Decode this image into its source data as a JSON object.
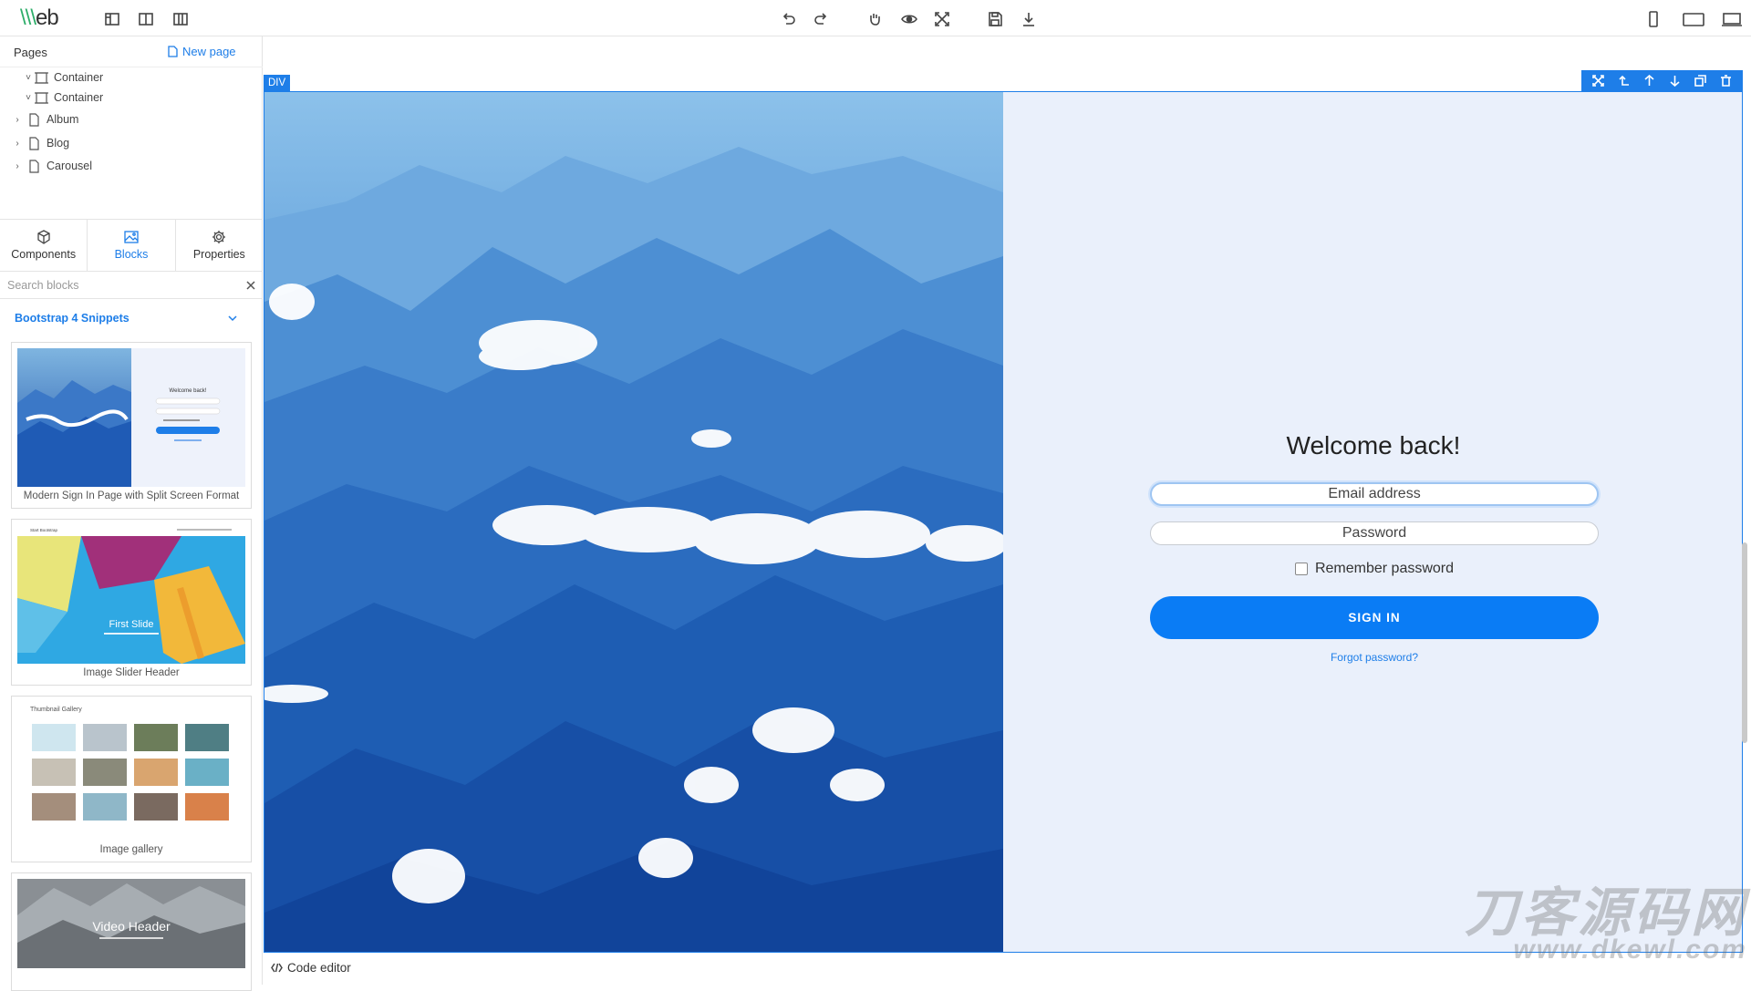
{
  "app": {
    "logo_a": "\\\\\\",
    "logo_b": "eb"
  },
  "toolbar": {
    "left_icons": [
      "layout-sidebar-left-icon",
      "layout-columns-icon",
      "layout-sidebar-right-icon"
    ],
    "center_icons": [
      "undo-icon",
      "redo-icon",
      "drag-hand-icon",
      "preview-eye-icon",
      "fullscreen-icon",
      "save-icon",
      "download-icon"
    ],
    "right_icons": [
      "mobile-view-icon",
      "tablet-view-icon",
      "desktop-view-icon"
    ]
  },
  "pages_panel": {
    "title": "Pages",
    "new_page_label": "New page",
    "tree": [
      {
        "label": "Container",
        "type": "container",
        "expanded": true
      },
      {
        "label": "Container",
        "type": "container",
        "expanded": true
      },
      {
        "label": "Album",
        "type": "page",
        "expanded": false
      },
      {
        "label": "Blog",
        "type": "page",
        "expanded": false
      },
      {
        "label": "Carousel",
        "type": "page",
        "expanded": false
      }
    ]
  },
  "tabs": [
    {
      "label": "Components",
      "icon": "cube-icon",
      "active": false
    },
    {
      "label": "Blocks",
      "icon": "image-icon",
      "active": true
    },
    {
      "label": "Properties",
      "icon": "gear-icon",
      "active": false
    }
  ],
  "blocks": {
    "search_placeholder": "Search blocks",
    "group_title": "Bootstrap 4 Snippets",
    "cards": [
      {
        "caption": "Modern Sign In Page with Split Screen Format",
        "mini_welcome": "Welcome back!"
      },
      {
        "caption": "Image Slider Header",
        "mini_brand": "Start Bootstrap",
        "mini_slide": "First Slide"
      },
      {
        "caption": "Image gallery",
        "mini_title": "Thumbnail Gallery"
      },
      {
        "caption": "",
        "mini_title": "Video Header"
      }
    ]
  },
  "canvas": {
    "selected_tag": "DIV",
    "selection_actions": [
      "select-parent-icon",
      "move-up-parent-icon",
      "arrow-up-icon",
      "arrow-down-icon",
      "clone-icon",
      "trash-icon"
    ],
    "signin": {
      "heading": "Welcome back!",
      "email_placeholder": "Email address",
      "password_placeholder": "Password",
      "remember_label": "Remember password",
      "button_label": "SIGN IN",
      "forgot_label": "Forgot password?"
    }
  },
  "footer": {
    "code_editor_label": "Code editor"
  },
  "watermark": {
    "line1": "刀客源码网",
    "line2": "www.dkewl.com"
  },
  "colors": {
    "accent": "#1e7ee8",
    "primary_button": "#0a7cf5",
    "form_bg": "#eaf0fb",
    "logo_green": "#2eae6a"
  }
}
